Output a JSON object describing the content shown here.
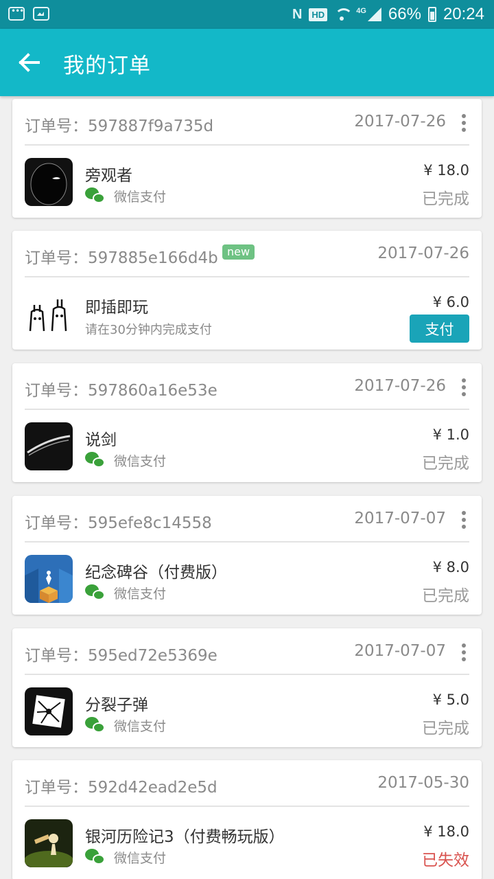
{
  "status_bar": {
    "battery": "66%",
    "time": "20:24",
    "hd": "HD",
    "network": "4G",
    "nfc": "N"
  },
  "toolbar": {
    "title": "我的订单"
  },
  "orders": [
    {
      "order_no": "订单号：597887f9a735d",
      "date": "2017-07-26",
      "app_name": "旁观者",
      "payment": "微信支付",
      "price": "¥ 18.0",
      "status": "已完成"
    },
    {
      "order_no": "订单号：597885e166d4b",
      "badge": "new",
      "date": "2017-07-26",
      "app_name": "即插即玩",
      "hint": "请在30分钟内完成支付",
      "price": "¥ 6.0",
      "action": "支付"
    },
    {
      "order_no": "订单号：597860a16e53e",
      "date": "2017-07-26",
      "app_name": "说剑",
      "payment": "微信支付",
      "price": "¥ 1.0",
      "status": "已完成"
    },
    {
      "order_no": "订单号：595efe8c14558",
      "date": "2017-07-07",
      "app_name": "纪念碑谷（付费版）",
      "payment": "微信支付",
      "price": "¥ 8.0",
      "status": "已完成"
    },
    {
      "order_no": "订单号：595ed72e5369e",
      "date": "2017-07-07",
      "app_name": "分裂子弹",
      "payment": "微信支付",
      "price": "¥ 5.0",
      "status": "已完成"
    },
    {
      "order_no": "订单号：592d42ead2e5d",
      "date": "2017-05-30",
      "app_name": "银河历险记3（付费畅玩版）",
      "payment": "微信支付",
      "price": "¥ 18.0",
      "status": "已失效"
    }
  ],
  "colors": {
    "primary": "#13b8c8",
    "status_bar": "#0f8e9c",
    "pay_button": "#1aa4b8",
    "wechat": "#3aa13a",
    "failed": "#d9534f",
    "badge": "#6ec283"
  }
}
